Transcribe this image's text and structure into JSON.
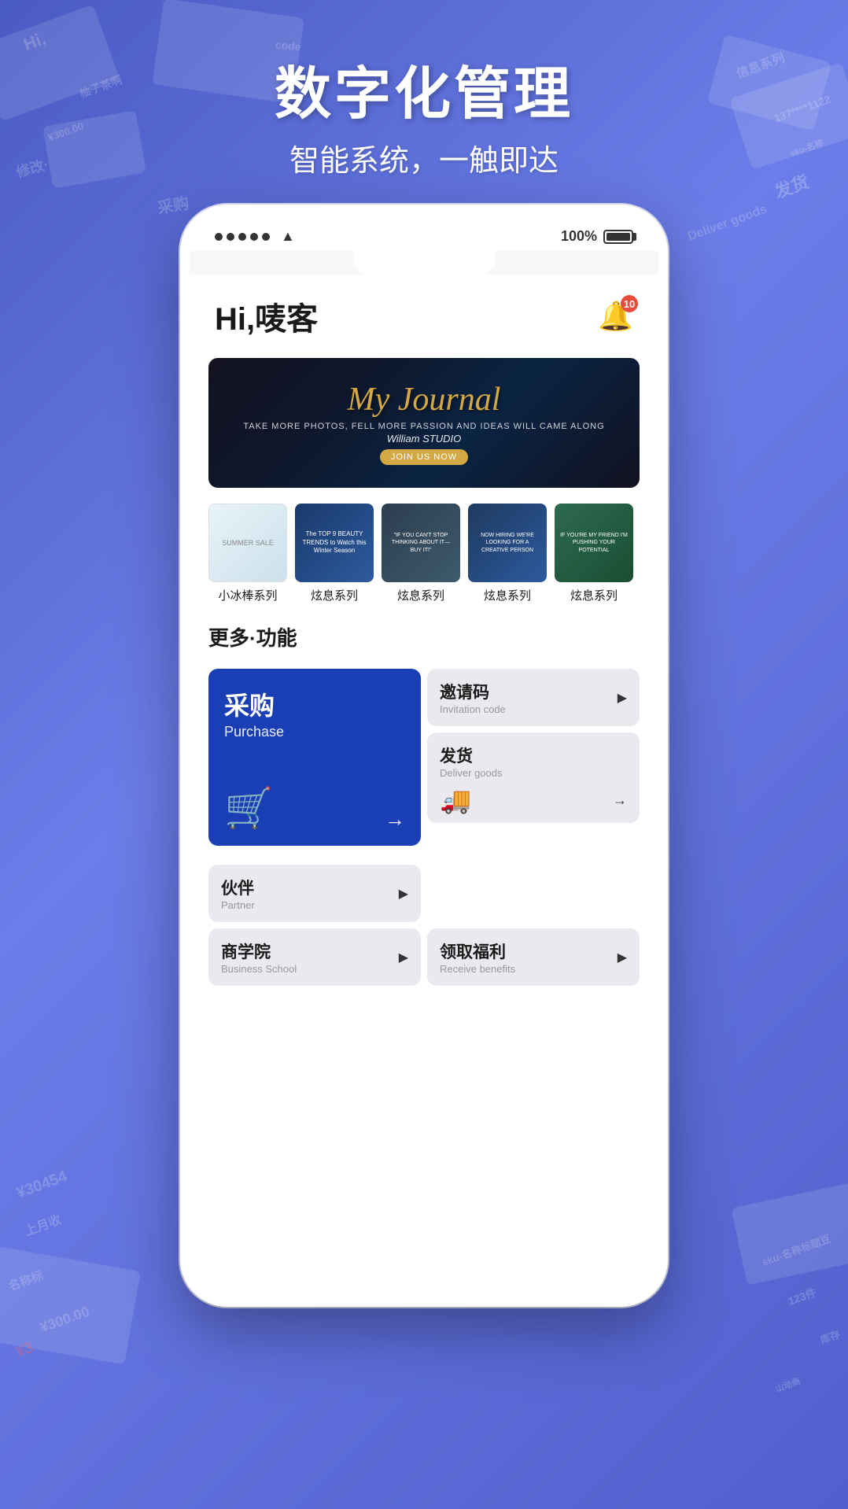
{
  "background": {
    "color": "#5a6fd6"
  },
  "header": {
    "title": "数字化管理",
    "subtitle": "智能系统，一触即达"
  },
  "statusBar": {
    "battery": "100%",
    "dots": 5
  },
  "app": {
    "greeting": "Hi,唛客",
    "bellBadge": "10",
    "banner": {
      "title": "My Journal",
      "subtitle": "TAKE MORE PHOTOS, FELL MORE PASSION\nAND IDEAS WILL CAME ALONG",
      "studio": "William STUDIO",
      "button": "JOIN US NOW"
    },
    "series": [
      {
        "label": "小冰棒系列",
        "theme": "light-blue"
      },
      {
        "label": "炫息系列",
        "theme": "dark-blue"
      },
      {
        "label": "炫息系列",
        "theme": "dark-mixed"
      },
      {
        "label": "炫息系列",
        "theme": "dark-navy"
      },
      {
        "label": "炫息系列",
        "theme": "dark-green"
      }
    ],
    "moreSection": {
      "title": "更多·功能"
    },
    "functions": [
      {
        "id": "purchase",
        "cn": "采购",
        "en": "Purchase",
        "type": "primary",
        "hasArrow": true,
        "hasCartIcon": true
      },
      {
        "id": "invitation",
        "cn": "邀请码",
        "en": "Invitation code",
        "type": "secondary",
        "hasArrow": true
      },
      {
        "id": "deliver",
        "cn": "发货",
        "en": "Deliver goods",
        "type": "secondary",
        "hasTruck": true,
        "hasArrow": true
      },
      {
        "id": "partner",
        "cn": "伙伴",
        "en": "Partner",
        "type": "secondary",
        "hasArrow": true
      },
      {
        "id": "business-school",
        "cn": "商学院",
        "en": "Business School",
        "type": "secondary",
        "hasArrow": true
      },
      {
        "id": "benefits",
        "cn": "领取福利",
        "en": "Receive benefits",
        "type": "secondary",
        "hasArrow": true
      }
    ]
  }
}
